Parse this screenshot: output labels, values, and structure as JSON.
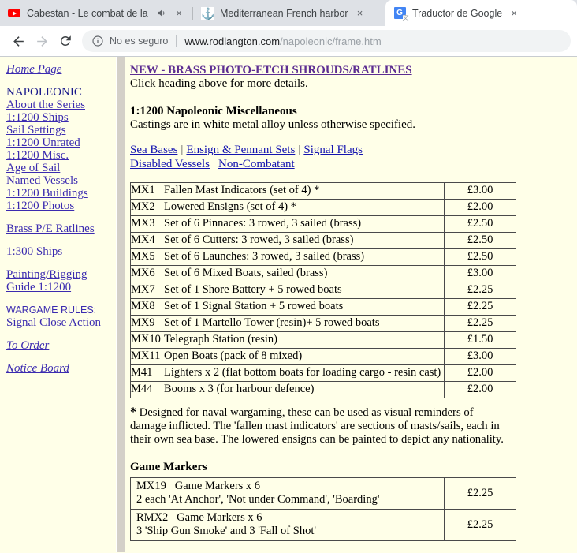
{
  "browser": {
    "tabs": [
      {
        "title": "Cabestan - Le combat de la D",
        "favicon": "youtube-icon",
        "audio_playing": true,
        "active": false,
        "close_label": "×"
      },
      {
        "title": "Mediterranean French harbor",
        "favicon": "anchor-icon",
        "audio_playing": false,
        "active": false,
        "close_label": "×"
      },
      {
        "title": "Traductor de Google",
        "favicon": "google-translate-icon",
        "audio_playing": false,
        "active": true,
        "close_label": "×"
      }
    ],
    "toolbar": {
      "back_label": "Back",
      "forward_label": "Forward",
      "reload_label": "Reload",
      "security_text": "No es seguro",
      "url_host": "www.rodlangton.com",
      "url_path": "/napoleonic/frame.htm",
      "url_full": "www.rodlangton.com/napoleonic/frame.htm"
    }
  },
  "sidebar": {
    "items": [
      {
        "label": "Home Page",
        "type": "link-italic"
      },
      {
        "label": "",
        "type": "gap"
      },
      {
        "label": "NAPOLEONIC",
        "type": "plain"
      },
      {
        "label": "About the Series",
        "type": "link"
      },
      {
        "label": "1:1200 Ships",
        "type": "link"
      },
      {
        "label": "Sail Settings",
        "type": "link"
      },
      {
        "label": "1:1200 Unrated",
        "type": "link"
      },
      {
        "label": "1:1200 Misc.",
        "type": "link"
      },
      {
        "label": "Age of Sail",
        "type": "link"
      },
      {
        "label": "Named Vessels",
        "type": "link"
      },
      {
        "label": "1:1200 Buildings",
        "type": "link"
      },
      {
        "label": "1:1200 Photos",
        "type": "link"
      },
      {
        "label": "",
        "type": "gap"
      },
      {
        "label": "Brass P/E Ratlines",
        "type": "link"
      },
      {
        "label": "",
        "type": "gap"
      },
      {
        "label": "1:300 Ships",
        "type": "link"
      },
      {
        "label": "",
        "type": "gap"
      },
      {
        "label": "Painting/Rigging",
        "type": "link"
      },
      {
        "label": "Guide 1:1200",
        "type": "link"
      },
      {
        "label": "",
        "type": "gap"
      },
      {
        "label": "WARGAME RULES:",
        "type": "sans"
      },
      {
        "label": "Signal Close Action",
        "type": "link"
      },
      {
        "label": "",
        "type": "gap"
      },
      {
        "label": "To Order",
        "type": "link-italic"
      },
      {
        "label": "",
        "type": "gap"
      },
      {
        "label": "Notice Board",
        "type": "link-italic"
      }
    ]
  },
  "main": {
    "promo_heading": "NEW  - BRASS PHOTO-ETCH SHROUDS/RATLINES",
    "promo_subtext": "Click heading above for more details.",
    "section_heading": "1:1200 Napoleonic Miscellaneous",
    "section_subtext": "Castings are in white metal alloy unless otherwise specified.",
    "nav_links_row1": [
      "Sea Bases",
      "Ensign & Pennant Sets",
      "Signal Flags"
    ],
    "nav_links_row2": [
      "Disabled Vessels",
      "Non-Combatant"
    ],
    "link_separator": "|",
    "products": [
      {
        "code": "MX1",
        "desc": "Fallen Mast Indicators (set of 4) *",
        "price": "£3.00"
      },
      {
        "code": "MX2",
        "desc": "Lowered Ensigns (set of 4) *",
        "price": "£2.00"
      },
      {
        "code": "MX3",
        "desc": "Set of 6 Pinnaces: 3 rowed, 3 sailed (brass)",
        "price": "£2.50"
      },
      {
        "code": "MX4",
        "desc": "Set of 6 Cutters: 3 rowed, 3 sailed (brass)",
        "price": "£2.50"
      },
      {
        "code": "MX5",
        "desc": "Set of 6 Launches: 3 rowed, 3 sailed (brass)",
        "price": "£2.50"
      },
      {
        "code": "MX6",
        "desc": "Set of 6 Mixed Boats, sailed (brass)",
        "price": "£3.00"
      },
      {
        "code": "MX7",
        "desc": "Set of 1 Shore Battery + 5 rowed boats",
        "price": "£2.25"
      },
      {
        "code": "MX8",
        "desc": "Set of 1 Signal Station + 5 rowed boats",
        "price": "£2.25"
      },
      {
        "code": "MX9",
        "desc": "Set of 1 Martello Tower (resin)+ 5 rowed boats",
        "price": "£2.25"
      },
      {
        "code": "MX10",
        "desc": "Telegraph Station (resin)",
        "price": "£1.50"
      },
      {
        "code": "MX11",
        "desc": "Open Boats (pack of 8 mixed)",
        "price": "£3.00"
      },
      {
        "code": "M41",
        "desc": "Lighters x 2 (flat bottom boats for loading cargo - resin cast)",
        "price": "£2.00"
      },
      {
        "code": "M44",
        "desc": "Booms x 3 (for harbour defence)",
        "price": "£2.00"
      }
    ],
    "footnote": "Designed for naval wargaming, these can be used as visual reminders of damage inflicted. The 'fallen mast indicators' are sections of masts/sails, each in their own sea base. The lowered ensigns can be painted to depict any nationality.",
    "footnote_marker": "*",
    "markers_heading": "Game Markers",
    "markers": [
      {
        "code": "MX19",
        "line1": "Game Markers x 6",
        "line2": "2 each 'At Anchor', 'Not under Command', 'Boarding'",
        "price": "£2.25"
      },
      {
        "code": "RMX2",
        "line1": "Game Markers x 6",
        "line2": "3 'Ship Gun Smoke' and 3 'Fall of Shot'",
        "price": "£2.25"
      }
    ]
  },
  "colors": {
    "page_bg": "#ffffe8",
    "link": "#3b2bb0",
    "promo_link": "#5c2d91",
    "chrome_bg": "#dee1e6",
    "frame_divider": "#d4d0c8"
  }
}
